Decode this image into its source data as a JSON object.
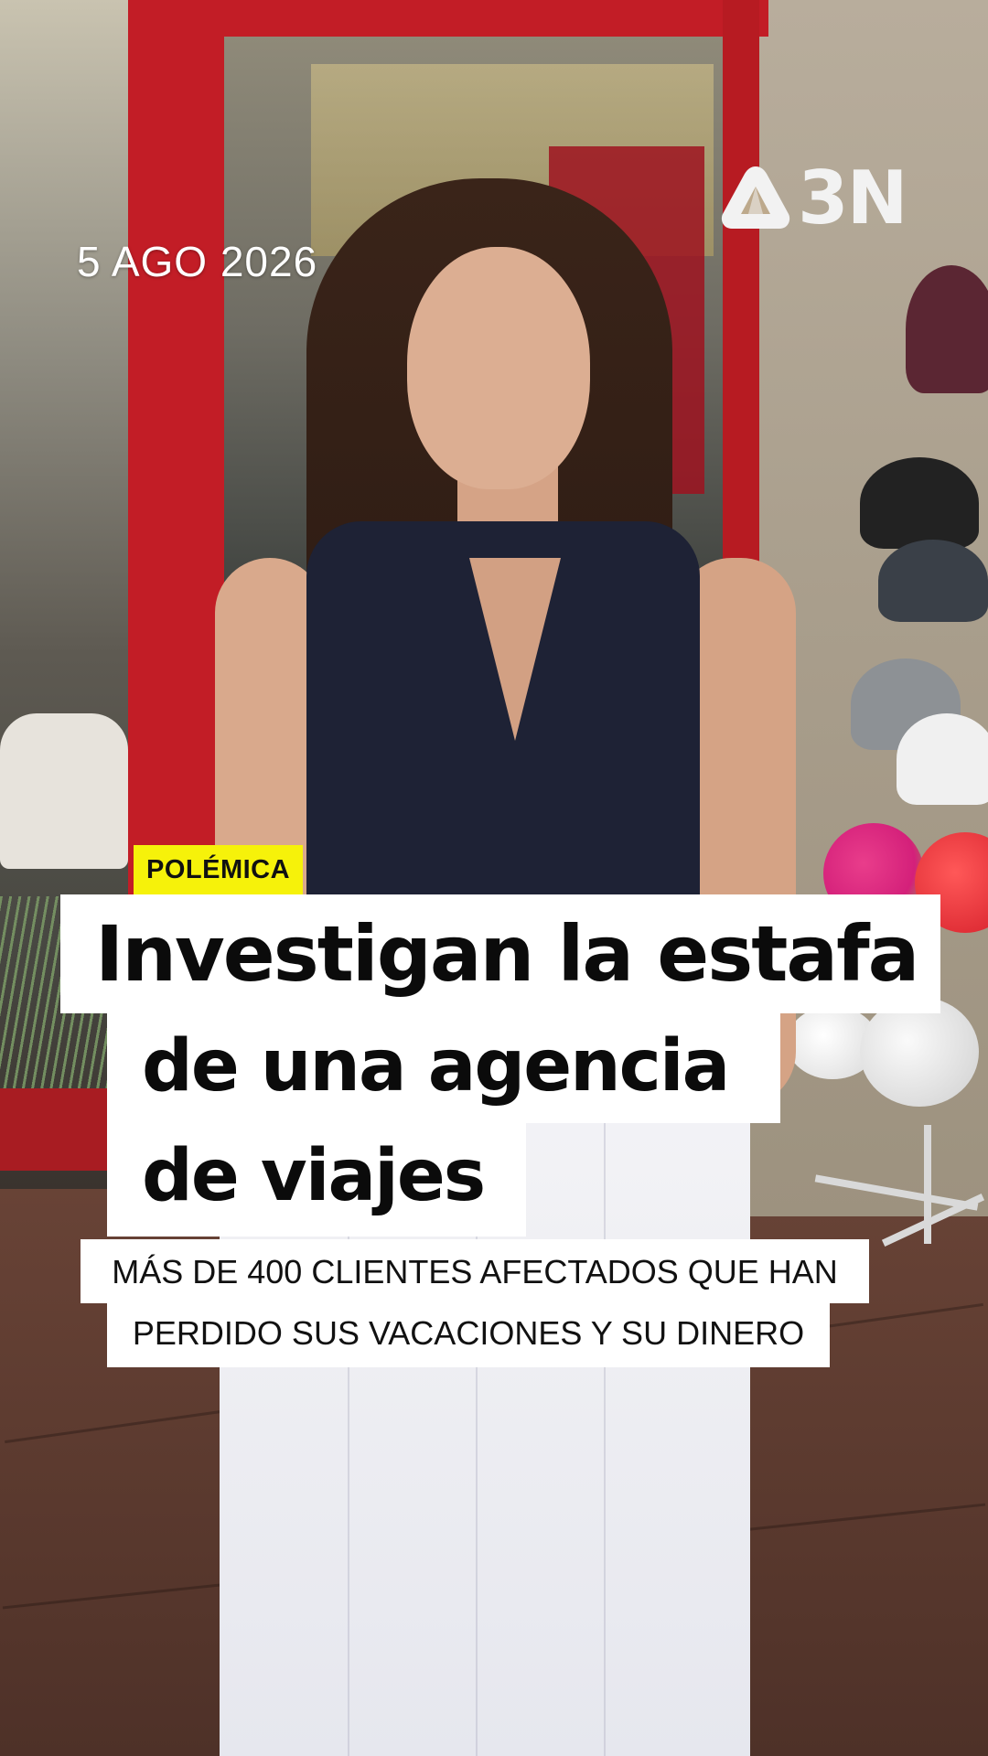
{
  "overlay": {
    "date": "5 AGO 2026",
    "logo": {
      "text": "3N",
      "icon": "antena3-triangle-icon"
    },
    "tag": "POLÉMICA",
    "headline_lines": [
      "Investigan la estafa",
      "de una agencia",
      "de viajes"
    ],
    "subtitle_lines": [
      "MÁS DE 400 CLIENTES AFECTADOS QUE HAN",
      "PERDIDO SUS VACACIONES Y SU DINERO"
    ]
  },
  "colors": {
    "tag_bg": "#f6f20a",
    "headline_bg": "#ffffff",
    "headline_text": "#0b0b0b",
    "brand_frame_red": "#c21d26"
  }
}
